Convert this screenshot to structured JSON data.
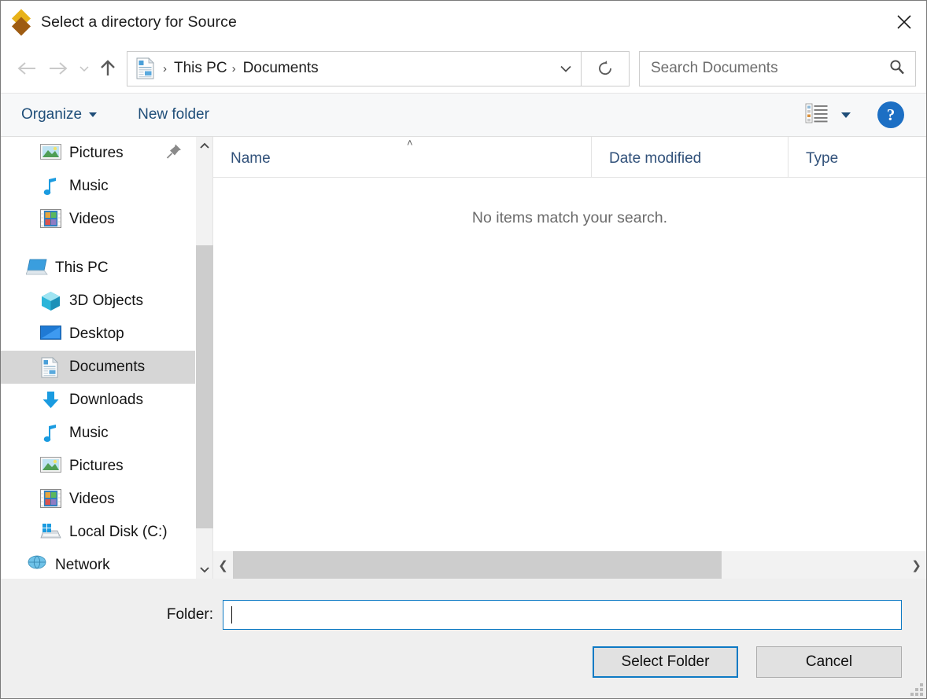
{
  "window": {
    "title": "Select a directory for Source",
    "app_icon": "diamond-logo-icon",
    "close_label": "×"
  },
  "navbar": {
    "back_icon": "back-arrow-icon",
    "forward_icon": "forward-arrow-icon",
    "recent_icon": "recent-locations-chevron-icon",
    "up_icon": "up-arrow-icon",
    "breadcrumb": {
      "location_icon": "documents-folder-icon",
      "separator": "›",
      "crumbs": [
        {
          "label": "This PC"
        },
        {
          "label": "Documents"
        }
      ],
      "dropdown_icon": "breadcrumb-chevron-down-icon"
    },
    "refresh_icon": "refresh-icon",
    "search": {
      "placeholder": "Search Documents",
      "value": "",
      "icon": "search-icon"
    }
  },
  "toolbar": {
    "organize_label": "Organize",
    "new_folder_label": "New folder",
    "view_icon": "view-layout-icon",
    "help_label": "?"
  },
  "sidebar": {
    "items": [
      {
        "label": "Pictures",
        "icon": "pictures-icon",
        "indent": "child",
        "selected": false,
        "pinned": true
      },
      {
        "label": "Music",
        "icon": "music-note-icon",
        "indent": "child",
        "selected": false,
        "pinned": false
      },
      {
        "label": "Videos",
        "icon": "videos-film-icon",
        "indent": "child",
        "selected": false,
        "pinned": false
      },
      {
        "label": "This PC",
        "icon": "this-pc-icon",
        "indent": "root",
        "selected": false,
        "pinned": false
      },
      {
        "label": "3D Objects",
        "icon": "3d-objects-cube-icon",
        "indent": "child",
        "selected": false,
        "pinned": false
      },
      {
        "label": "Desktop",
        "icon": "desktop-icon",
        "indent": "child",
        "selected": false,
        "pinned": false
      },
      {
        "label": "Documents",
        "icon": "documents-icon",
        "indent": "child",
        "selected": true,
        "pinned": false
      },
      {
        "label": "Downloads",
        "icon": "downloads-arrow-icon",
        "indent": "child",
        "selected": false,
        "pinned": false
      },
      {
        "label": "Music",
        "icon": "music-note-icon",
        "indent": "child",
        "selected": false,
        "pinned": false
      },
      {
        "label": "Pictures",
        "icon": "pictures-icon",
        "indent": "child",
        "selected": false,
        "pinned": false
      },
      {
        "label": "Videos",
        "icon": "videos-film-icon",
        "indent": "child",
        "selected": false,
        "pinned": false
      },
      {
        "label": "Local Disk (C:)",
        "icon": "local-disk-icon",
        "indent": "child",
        "selected": false,
        "pinned": false
      },
      {
        "label": "Network",
        "icon": "network-icon",
        "indent": "root",
        "selected": false,
        "pinned": false
      }
    ],
    "scroll_up_icon": "scroll-up-chevron-icon",
    "scroll_down_icon": "scroll-down-chevron-icon"
  },
  "filepane": {
    "columns": [
      {
        "label": "Name",
        "sorted": "ascending",
        "sort_glyph": "˄"
      },
      {
        "label": "Date modified",
        "sorted": "none",
        "sort_glyph": ""
      },
      {
        "label": "Type",
        "sorted": "none",
        "sort_glyph": ""
      }
    ],
    "rows": [],
    "empty_message": "No items match your search.",
    "hscroll_left_glyph": "❮",
    "hscroll_right_glyph": "❯"
  },
  "footer": {
    "folder_label": "Folder:",
    "folder_value": "",
    "select_button": "Select Folder",
    "cancel_button": "Cancel"
  },
  "colors": {
    "accent_blue": "#0e7ac4",
    "link_blue": "#1f4e79",
    "selection_gray": "#d6d6d6",
    "footer_gray": "#efefef",
    "toolbar_gray": "#f7f8f9",
    "scroll_thumb": "#cdcdcd",
    "logo_top": "#e8b219",
    "logo_bottom": "#9e5c12"
  }
}
